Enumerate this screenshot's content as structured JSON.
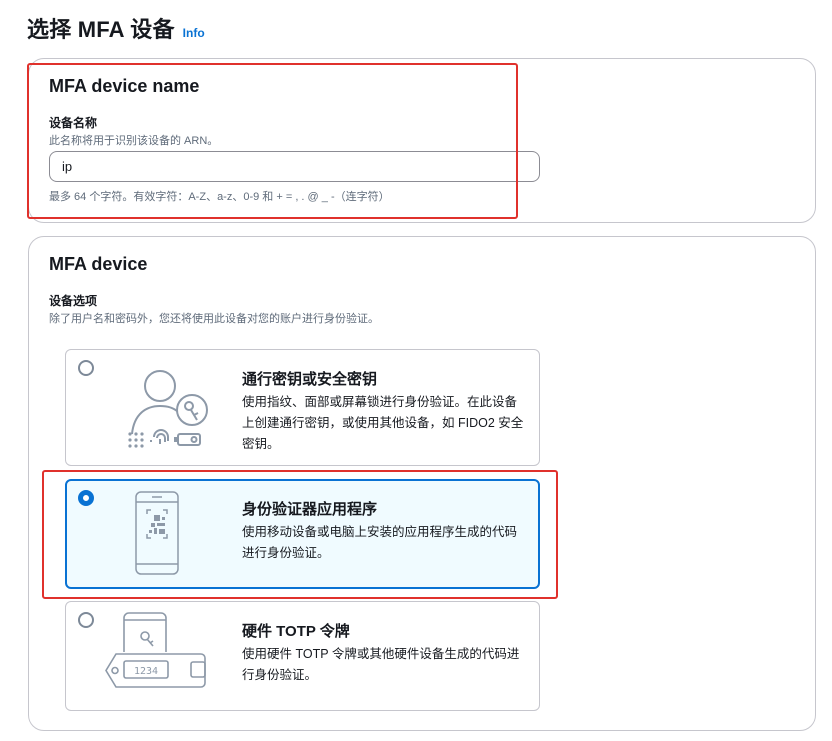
{
  "page": {
    "title": "选择 MFA 设备",
    "info_label": "Info"
  },
  "name_panel": {
    "heading": "MFA device name",
    "field_label": "设备名称",
    "field_description": "此名称将用于识别该设备的 ARN。",
    "input_value": "ip",
    "constraint_text": "最多 64 个字符。有效字符：A-Z、a-z、0-9 和 + = , . @ _ -（连字符）"
  },
  "device_panel": {
    "heading": "MFA device",
    "options_label": "设备选项",
    "options_description": "除了用户名和密码外，您还将使用此设备对您的账户进行身份验证。",
    "options": [
      {
        "title": "通行密钥或安全密钥",
        "description": "使用指纹、面部或屏幕锁进行身份验证。在此设备上创建通行密钥，或使用其他设备，如 FIDO2 安全密钥。",
        "selected": false,
        "icon": "passkey-icon"
      },
      {
        "title": "身份验证器应用程序",
        "description": "使用移动设备或电脑上安装的应用程序生成的代码进行身份验证。",
        "selected": true,
        "icon": "authenticator-app-icon"
      },
      {
        "title": "硬件 TOTP 令牌",
        "description": "使用硬件 TOTP 令牌或其他硬件设备生成的代码进行身份验证。",
        "selected": false,
        "icon": "hardware-token-icon",
        "token_display": "1234"
      }
    ]
  },
  "colors": {
    "accent": "#0972d3",
    "highlight_annotation": "#e0312c",
    "selected_background": "#f0fbff",
    "border": "#c6c6cd",
    "illustration": "#8d99a8"
  }
}
